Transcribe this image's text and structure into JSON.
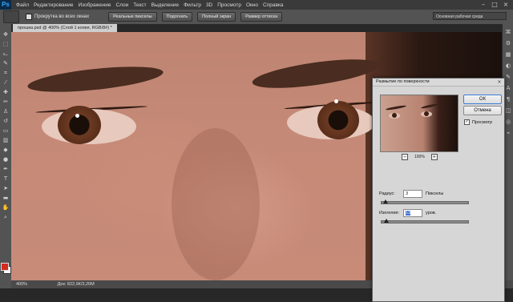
{
  "app": {
    "logo": "Ps"
  },
  "menu": [
    "Файл",
    "Редактирование",
    "Изображение",
    "Слои",
    "Текст",
    "Выделение",
    "Фильтр",
    "3D",
    "Просмотр",
    "Окно",
    "Справка"
  ],
  "window_controls": {
    "minimize": "–",
    "maximize": "□",
    "close": "×"
  },
  "options": {
    "checkbox_label": "Прокрутка во всех окнах",
    "buttons": [
      "Реальные пикселы",
      "Подогнать",
      "Полный экран",
      "Размер оттиска"
    ],
    "workspace": "Основная рабочая среда"
  },
  "document": {
    "tab_title": "прошка.psd @ 400% (Слой 1 копия, RGB/8#) *",
    "zoom": "400%",
    "doc_info": "Док: 822,9К/3,20М"
  },
  "colors": {
    "foreground": "#d42a20",
    "background": "#ffffff",
    "accent": "#3b7cd8"
  },
  "dialog": {
    "title": "Размытие по поверхности",
    "close": "×",
    "ok": "ОК",
    "cancel": "Отмена",
    "preview_label": "Просмотр",
    "preview_checked": true,
    "preview_zoom": "100%",
    "zoom_minus": "−",
    "zoom_plus": "+",
    "radius_label": "Радиус:",
    "radius_value": "3",
    "radius_unit": "Пикселы",
    "radius_slider": 0.05,
    "threshold_label": "Изогелия:",
    "threshold_value": "13",
    "threshold_unit": "уров.",
    "threshold_slider": 0.06
  }
}
